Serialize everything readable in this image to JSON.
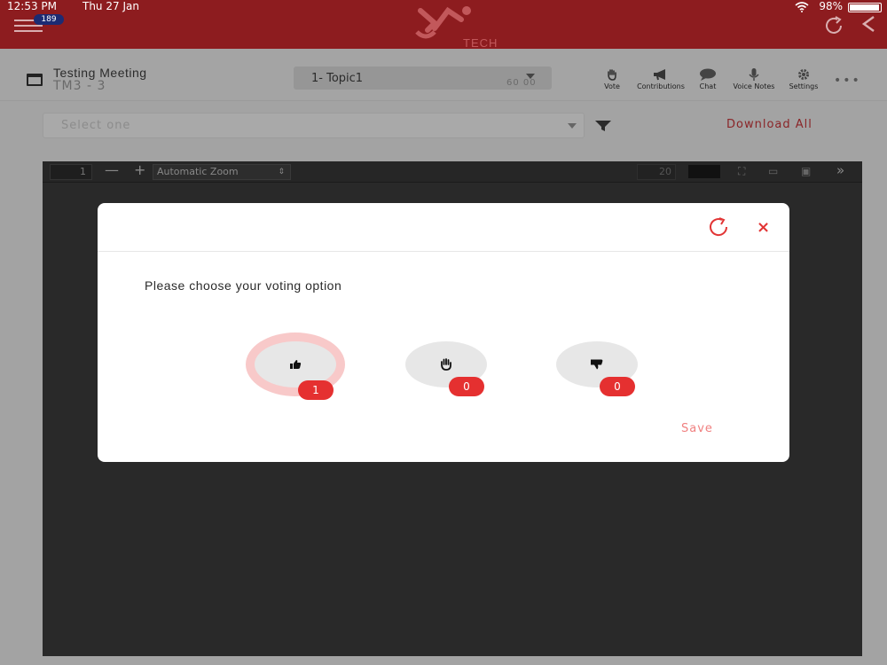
{
  "status_bar": {
    "time": "12:53 PM",
    "date": "Thu 27 Jan",
    "battery": "98%"
  },
  "app": {
    "badge_count": "189",
    "logo_text": "TECH"
  },
  "meeting": {
    "title": "Testing Meeting",
    "subtitle": "TM3 - 3",
    "topic_selected": "1- Topic1",
    "topic_time": "60 00"
  },
  "toolbar_items": [
    {
      "label": "Vote",
      "icon": "hand-icon"
    },
    {
      "label": "Contributions",
      "icon": "megaphone-icon"
    },
    {
      "label": "Chat",
      "icon": "chat-icon"
    },
    {
      "label": "Voice Notes",
      "icon": "microphone-icon"
    },
    {
      "label": "Settings",
      "icon": "gear-icon"
    }
  ],
  "filter": {
    "placeholder": "Select one",
    "download_label": "Download All"
  },
  "viewer": {
    "page_number": "1",
    "zoom": "Automatic Zoom",
    "page_count": "20"
  },
  "modal": {
    "prompt": "Please choose your voting option",
    "options": [
      {
        "icon": "thumbs-up-icon",
        "count": "1",
        "selected": true
      },
      {
        "icon": "hand-icon",
        "count": "0",
        "selected": false
      },
      {
        "icon": "thumbs-down-icon",
        "count": "0",
        "selected": false
      }
    ],
    "save_label": "Save"
  },
  "colors": {
    "top_bar": "#8d1c1f",
    "accent_red": "#e53030",
    "save_text": "#f08080",
    "selected_ring": "#f8c9c9"
  }
}
